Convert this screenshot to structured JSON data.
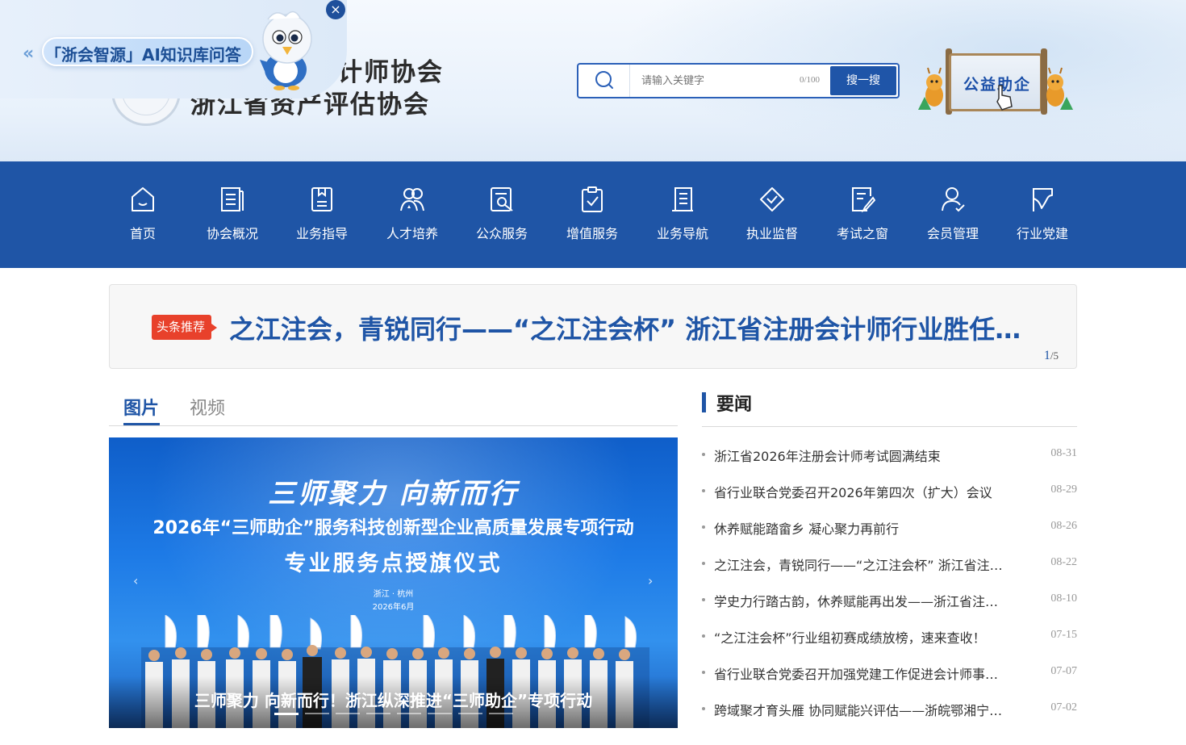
{
  "header": {
    "org_name_line1": "浙江省注册会计师协会",
    "org_name_line1_visible": "计师协会",
    "org_name_line2": "浙江省资产评估协会",
    "ai_badge_text": "「浙会智源」AI知识库问答",
    "search": {
      "placeholder": "请输入关键字",
      "counter": "0/100",
      "button_label": "搜一搜"
    },
    "charity_label": "公益助企"
  },
  "nav": {
    "items": [
      {
        "label": "首页",
        "icon": "home-icon"
      },
      {
        "label": "协会概况",
        "icon": "document-list-icon"
      },
      {
        "label": "业务指导",
        "icon": "book-icon"
      },
      {
        "label": "人才培养",
        "icon": "people-icon"
      },
      {
        "label": "公众服务",
        "icon": "search-document-icon"
      },
      {
        "label": "增值服务",
        "icon": "clipboard-check-icon"
      },
      {
        "label": "业务导航",
        "icon": "notebook-icon"
      },
      {
        "label": "执业监督",
        "icon": "shield-check-icon"
      },
      {
        "label": "考试之窗",
        "icon": "exam-edit-icon"
      },
      {
        "label": "会员管理",
        "icon": "user-check-icon"
      },
      {
        "label": "行业党建",
        "icon": "flag-icon"
      }
    ]
  },
  "headline": {
    "tag": "头条推荐",
    "title": "之江注会，青锐同行——“之江注会杯” 浙江省注册会计师行业胜任…",
    "pager_current": "1",
    "pager_total": "/5"
  },
  "media": {
    "tabs": [
      "图片",
      "视频"
    ],
    "active_tab": "图片",
    "slide": {
      "banner_line1": "三师聚力 向新而行",
      "banner_line2": "2026年“三师助企”服务科技创新型企业高质量发展专项行动",
      "banner_line3": "专业服务点授旗仪式",
      "banner_location": "浙江 · 杭州",
      "banner_date": "2026年6月",
      "caption": "三师聚力 向新而行！浙江纵深推进“三师助企”专项行动"
    },
    "slide_count": 8,
    "active_slide": 1
  },
  "news": {
    "title": "要闻",
    "items": [
      {
        "text": "浙江省2026年注册会计师考试圆满结束",
        "date": "08-31"
      },
      {
        "text": "省行业联合党委召开2026年第四次（扩大）会议",
        "date": "08-29"
      },
      {
        "text": "休养赋能踏畲乡 凝心聚力再前行",
        "date": "08-26"
      },
      {
        "text": "之江注会，青锐同行——“之江注会杯” 浙江省注…",
        "date": "08-22"
      },
      {
        "text": "学史力行踏古韵，休养赋能再出发——浙江省注…",
        "date": "08-10"
      },
      {
        "text": "“之江注会杯”行业组初赛成绩放榜，速来查收！",
        "date": "07-15"
      },
      {
        "text": "省行业联合党委召开加强党建工作促进会计师事…",
        "date": "07-07"
      },
      {
        "text": "跨域聚才育头雁 协同赋能兴评估——浙皖鄂湘宁…",
        "date": "07-02"
      }
    ]
  },
  "colors": {
    "brand_blue": "#1f55a6",
    "tag_red": "#e8412b"
  }
}
